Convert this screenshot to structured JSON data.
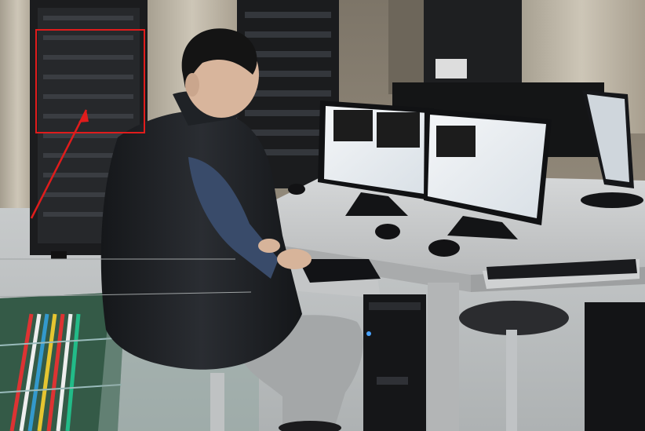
{
  "scene": {
    "description_ref": "photo",
    "colors": {
      "wall": "#8f8678",
      "curtain": "#b9b2a3",
      "rack": "#1b1c1e",
      "desk": "#c9cbcc",
      "floor": "#bfc3c4",
      "glass_floor": "#2d4a3a",
      "vest": "#1a1c1f",
      "shirt": "#3a4c6a",
      "pants": "#a7aaab",
      "highlight_box": "#e01c1c",
      "screen": "#e9eef2"
    }
  }
}
